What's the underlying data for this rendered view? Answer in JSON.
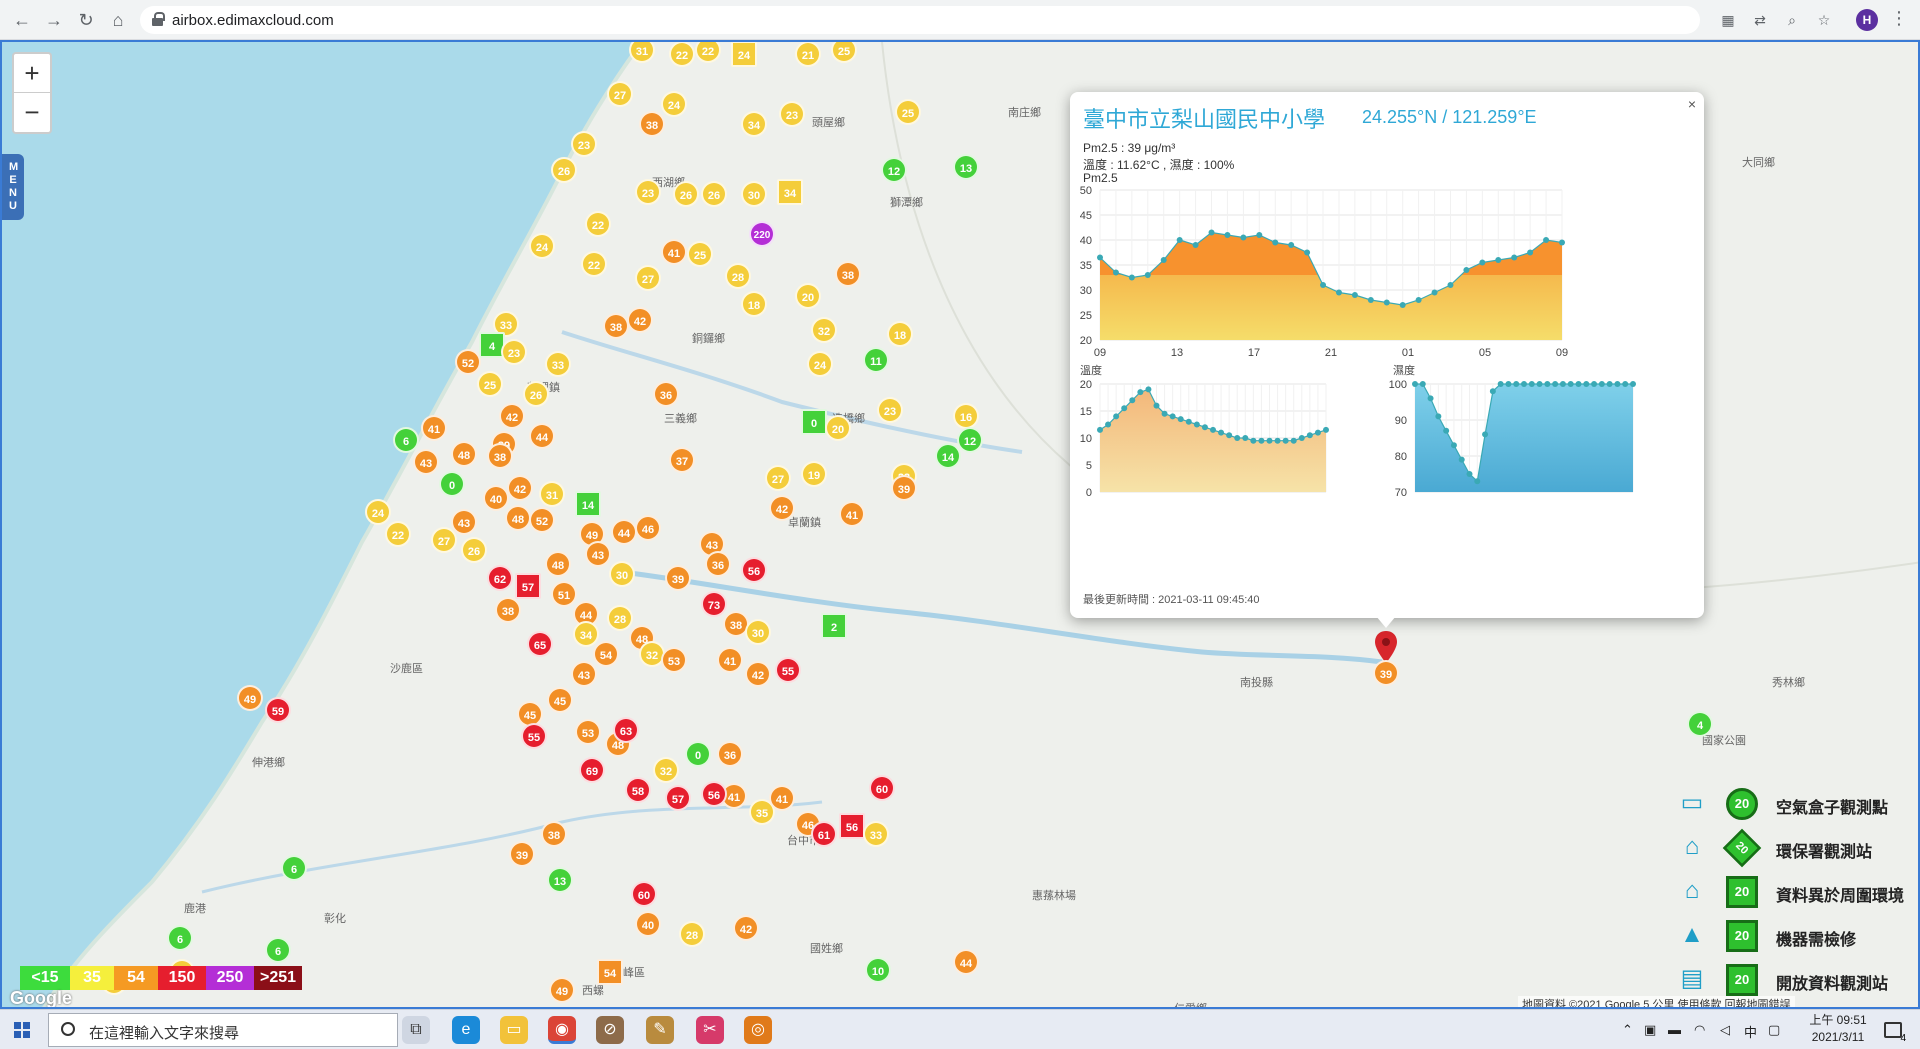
{
  "browser": {
    "url": "airbox.edimaxcloud.com",
    "avatar_letter": "H"
  },
  "map": {
    "zoom_in": "+",
    "zoom_out": "−",
    "menu_label": "MENU",
    "places": [
      {
        "text": "西湖鄉"
      },
      {
        "text": "頭屋鄉"
      },
      {
        "text": "南庄鄉"
      },
      {
        "text": "獅潭鄉"
      },
      {
        "text": "大同鄉"
      },
      {
        "text": "銅鑼鄉"
      },
      {
        "text": "苑裡鎮"
      },
      {
        "text": "三義鄉"
      },
      {
        "text": "卓蘭鎮"
      },
      {
        "text": "沙鹿區"
      },
      {
        "text": "伸港鄉"
      },
      {
        "text": "鹿港"
      },
      {
        "text": "彰化"
      },
      {
        "text": "台中市"
      },
      {
        "text": "南投縣"
      },
      {
        "text": "國姓鄉"
      },
      {
        "text": "惠蓀林場"
      },
      {
        "text": "霧峰區"
      },
      {
        "text": "仁愛鄉"
      },
      {
        "text": "秀林鄉"
      },
      {
        "text": "國家公園"
      },
      {
        "text": "造橋鄉"
      },
      {
        "text": "西螺"
      }
    ],
    "markers": [
      {
        "v": "31",
        "c": "yellow"
      },
      {
        "v": "22",
        "c": "yellow"
      },
      {
        "v": "22",
        "c": "yellow"
      },
      {
        "v": "24",
        "c": "yellow"
      },
      {
        "v": "21",
        "c": "yellow"
      },
      {
        "v": "25",
        "c": "yellow"
      },
      {
        "v": "27",
        "c": "yellow"
      },
      {
        "v": "24",
        "c": "yellow"
      },
      {
        "v": "38",
        "c": "orange"
      },
      {
        "v": "34",
        "c": "yellow"
      },
      {
        "v": "23",
        "c": "yellow"
      },
      {
        "v": "25",
        "c": "yellow"
      },
      {
        "v": "23",
        "c": "yellow"
      },
      {
        "v": "26",
        "c": "yellow"
      },
      {
        "v": "12",
        "c": "green"
      },
      {
        "v": "13",
        "c": "green"
      },
      {
        "v": "23",
        "c": "yellow"
      },
      {
        "v": "26",
        "c": "yellow"
      },
      {
        "v": "26",
        "c": "yellow"
      },
      {
        "v": "30",
        "c": "yellow"
      },
      {
        "v": "34",
        "c": "yellow"
      },
      {
        "v": "22",
        "c": "yellow"
      },
      {
        "v": "220",
        "c": "purple"
      },
      {
        "v": "24",
        "c": "yellow"
      },
      {
        "v": "41",
        "c": "orange"
      },
      {
        "v": "25",
        "c": "yellow"
      },
      {
        "v": "38",
        "c": "orange"
      },
      {
        "v": "22",
        "c": "yellow"
      },
      {
        "v": "27",
        "c": "yellow"
      },
      {
        "v": "28",
        "c": "yellow"
      },
      {
        "v": "18",
        "c": "yellow"
      },
      {
        "v": "20",
        "c": "yellow"
      },
      {
        "v": "33",
        "c": "yellow"
      },
      {
        "v": "38",
        "c": "orange"
      },
      {
        "v": "42",
        "c": "orange"
      },
      {
        "v": "32",
        "c": "yellow"
      },
      {
        "v": "18",
        "c": "yellow"
      },
      {
        "v": "4",
        "c": "green"
      },
      {
        "v": "23",
        "c": "yellow"
      },
      {
        "v": "33",
        "c": "yellow"
      },
      {
        "v": "24",
        "c": "yellow"
      },
      {
        "v": "11",
        "c": "green"
      },
      {
        "v": "52",
        "c": "orange"
      },
      {
        "v": "25",
        "c": "yellow"
      },
      {
        "v": "26",
        "c": "yellow"
      },
      {
        "v": "36",
        "c": "orange"
      },
      {
        "v": "23",
        "c": "yellow"
      },
      {
        "v": "16",
        "c": "yellow"
      },
      {
        "v": "42",
        "c": "orange"
      },
      {
        "v": "12",
        "c": "green"
      },
      {
        "v": "6",
        "c": "green"
      },
      {
        "v": "41",
        "c": "orange"
      },
      {
        "v": "39",
        "c": "orange"
      },
      {
        "v": "44",
        "c": "orange"
      },
      {
        "v": "0",
        "c": "green"
      },
      {
        "v": "20",
        "c": "yellow"
      },
      {
        "v": "43",
        "c": "orange"
      },
      {
        "v": "48",
        "c": "orange"
      },
      {
        "v": "38",
        "c": "orange"
      },
      {
        "v": "37",
        "c": "orange"
      },
      {
        "v": "27",
        "c": "yellow"
      },
      {
        "v": "19",
        "c": "yellow"
      },
      {
        "v": "23",
        "c": "yellow"
      },
      {
        "v": "14",
        "c": "green"
      },
      {
        "v": "0",
        "c": "green"
      },
      {
        "v": "40",
        "c": "orange"
      },
      {
        "v": "42",
        "c": "orange"
      },
      {
        "v": "31",
        "c": "yellow"
      },
      {
        "v": "39",
        "c": "orange"
      },
      {
        "v": "42",
        "c": "orange"
      },
      {
        "v": "41",
        "c": "orange"
      },
      {
        "v": "14",
        "c": "green"
      },
      {
        "v": "24",
        "c": "yellow"
      },
      {
        "v": "22",
        "c": "yellow"
      },
      {
        "v": "27",
        "c": "yellow"
      },
      {
        "v": "43",
        "c": "orange"
      },
      {
        "v": "26",
        "c": "yellow"
      },
      {
        "v": "48",
        "c": "orange"
      },
      {
        "v": "52",
        "c": "orange"
      },
      {
        "v": "49",
        "c": "orange"
      },
      {
        "v": "43",
        "c": "orange"
      },
      {
        "v": "44",
        "c": "orange"
      },
      {
        "v": "46",
        "c": "orange"
      },
      {
        "v": "43",
        "c": "orange"
      },
      {
        "v": "36",
        "c": "orange"
      },
      {
        "v": "30",
        "c": "yellow"
      },
      {
        "v": "39",
        "c": "orange"
      },
      {
        "v": "48",
        "c": "orange"
      },
      {
        "v": "57",
        "c": "red"
      },
      {
        "v": "62",
        "c": "red"
      },
      {
        "v": "38",
        "c": "orange"
      },
      {
        "v": "51",
        "c": "orange"
      },
      {
        "v": "44",
        "c": "orange"
      },
      {
        "v": "28",
        "c": "yellow"
      },
      {
        "v": "73",
        "c": "red"
      },
      {
        "v": "56",
        "c": "red"
      },
      {
        "v": "65",
        "c": "red"
      },
      {
        "v": "34",
        "c": "yellow"
      },
      {
        "v": "48",
        "c": "orange"
      },
      {
        "v": "54",
        "c": "orange"
      },
      {
        "v": "32",
        "c": "yellow"
      },
      {
        "v": "53",
        "c": "orange"
      },
      {
        "v": "41",
        "c": "orange"
      },
      {
        "v": "38",
        "c": "orange"
      },
      {
        "v": "30",
        "c": "yellow"
      },
      {
        "v": "2",
        "c": "green"
      },
      {
        "v": "42",
        "c": "orange"
      },
      {
        "v": "55",
        "c": "red"
      },
      {
        "v": "49",
        "c": "orange"
      },
      {
        "v": "59",
        "c": "red"
      },
      {
        "v": "43",
        "c": "orange"
      },
      {
        "v": "45",
        "c": "orange"
      },
      {
        "v": "45",
        "c": "orange"
      },
      {
        "v": "55",
        "c": "red"
      },
      {
        "v": "53",
        "c": "orange"
      },
      {
        "v": "48",
        "c": "orange"
      },
      {
        "v": "36",
        "c": "orange"
      },
      {
        "v": "32",
        "c": "yellow"
      },
      {
        "v": "0",
        "c": "green"
      },
      {
        "v": "41",
        "c": "orange"
      },
      {
        "v": "35",
        "c": "yellow"
      },
      {
        "v": "46",
        "c": "orange"
      },
      {
        "v": "56",
        "c": "red"
      },
      {
        "v": "63",
        "c": "red"
      },
      {
        "v": "69",
        "c": "red"
      },
      {
        "v": "58",
        "c": "red"
      },
      {
        "v": "57",
        "c": "red"
      },
      {
        "v": "60",
        "c": "red"
      },
      {
        "v": "56",
        "c": "red"
      },
      {
        "v": "41",
        "c": "orange"
      },
      {
        "v": "61",
        "c": "red"
      },
      {
        "v": "33",
        "c": "yellow"
      },
      {
        "v": "38",
        "c": "orange"
      },
      {
        "v": "39",
        "c": "orange"
      },
      {
        "v": "13",
        "c": "green"
      },
      {
        "v": "60",
        "c": "red"
      },
      {
        "v": "40",
        "c": "orange"
      },
      {
        "v": "28",
        "c": "yellow"
      },
      {
        "v": "42",
        "c": "orange"
      },
      {
        "v": "54",
        "c": "orange"
      },
      {
        "v": "49",
        "c": "orange"
      },
      {
        "v": "44",
        "c": "orange"
      },
      {
        "v": "10",
        "c": "green"
      },
      {
        "v": "6",
        "c": "green"
      },
      {
        "v": "6",
        "c": "green"
      },
      {
        "v": "22",
        "c": "yellow"
      },
      {
        "v": "16",
        "c": "yellow"
      },
      {
        "v": "6",
        "c": "green"
      },
      {
        "v": "4",
        "c": "green"
      }
    ],
    "selected_marker": "39",
    "scale_bar": [
      "<15",
      "35",
      "54",
      "150",
      "250",
      ">251"
    ],
    "scale_colors": [
      "#3ddc3d",
      "#f5ef3c",
      "#f59a23",
      "#e61e2e",
      "#b42ed6",
      "#8b0f18"
    ],
    "attribution": "地圖資料 ©2021 Google    5 公里      使用條款    回報地圖錯誤",
    "google_logo": "Google"
  },
  "popup": {
    "close": "×",
    "title": "臺中市立梨山國民中小學",
    "coord": "24.255°N / 121.259°E",
    "pm_line": "Pm2.5 : 39 μg/m³",
    "temp_line": "溫度 : 11.62°C , 濕度 : 100%",
    "chart_label": "Pm2.5",
    "updated": "最後更新時間 : 2021-03-11 09:45:40"
  },
  "chart_data": [
    {
      "type": "area",
      "title": "Pm2.5",
      "x_ticks": [
        "09",
        "13",
        "17",
        "21",
        "01",
        "05",
        "09"
      ],
      "ylim": [
        20,
        50
      ],
      "y_ticks": [
        20,
        25,
        30,
        35,
        40,
        45,
        50
      ],
      "values": [
        36.5,
        33.5,
        32.5,
        33,
        36,
        40,
        39,
        41.5,
        41,
        40.5,
        41,
        39.5,
        39,
        37.5,
        31,
        29.5,
        29,
        28,
        27.5,
        27,
        28,
        29.5,
        31,
        34,
        35.5,
        36,
        36.5,
        37.5,
        40,
        39.5
      ],
      "grid": true
    },
    {
      "type": "area",
      "title": "溫度",
      "ylim": [
        0,
        20
      ],
      "y_ticks": [
        0,
        5,
        10,
        15,
        20
      ],
      "values": [
        11.5,
        12.5,
        14,
        15.5,
        17,
        18.5,
        19,
        16,
        14.5,
        14,
        13.5,
        13,
        12.5,
        12,
        11.5,
        11,
        10.5,
        10,
        10,
        9.5,
        9.5,
        9.5,
        9.5,
        9.5,
        9.5,
        10,
        10.5,
        11,
        11.5
      ],
      "grid": true
    },
    {
      "type": "area",
      "title": "濕度",
      "ylim": [
        70,
        100
      ],
      "y_ticks": [
        70,
        80,
        90,
        100
      ],
      "values": [
        100,
        100,
        96,
        91,
        87,
        83,
        79,
        75,
        73,
        86,
        98,
        100,
        100,
        100,
        100,
        100,
        100,
        100,
        100,
        100,
        100,
        100,
        100,
        100,
        100,
        100,
        100,
        100,
        100
      ],
      "grid": true
    }
  ],
  "legend": [
    {
      "label": "空氣盒子觀測點",
      "badge": "20",
      "icon": "airbox-icon",
      "glyph": "▭"
    },
    {
      "label": "環保署觀測站",
      "badge": "20",
      "icon": "government-building-icon",
      "glyph": "⌂"
    },
    {
      "label": "資料異於周圍環境",
      "badge": "20",
      "icon": "house-icon",
      "glyph": "⌂"
    },
    {
      "label": "機器需檢修",
      "badge": "20",
      "icon": "cone-icon",
      "glyph": "▲"
    },
    {
      "label": "開放資料觀測站",
      "badge": "20",
      "icon": "open-data-icon",
      "glyph": "▤"
    }
  ],
  "taskbar": {
    "search_placeholder": "在這裡輸入文字來搜尋",
    "ime": "中",
    "time": "上午 09:51",
    "date": "2021/3/11",
    "notif_count": "4"
  }
}
